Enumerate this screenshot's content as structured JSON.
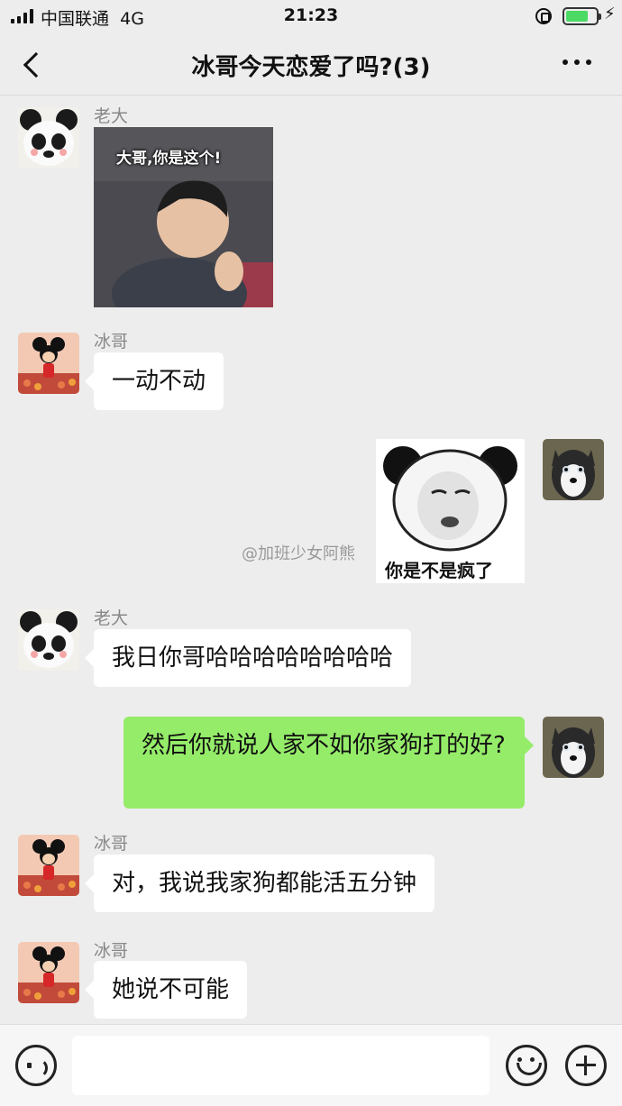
{
  "status_bar": {
    "carrier": "中国联通",
    "network": "4G",
    "time": "21:23",
    "battery_level": 0.75,
    "battery_color": "#4cd964"
  },
  "nav": {
    "back_icon": "chevron-left-icon",
    "title": "冰哥今天恋爱了吗?(3)",
    "more_icon": "more-dots-icon"
  },
  "colors": {
    "background": "#ededed",
    "outgoing_bubble": "#95ec69",
    "incoming_bubble": "#ffffff",
    "sender_name": "#888888"
  },
  "messages": [
    {
      "sender": "老大",
      "type": "sticker",
      "caption": "大哥,你是这个!",
      "direction": "incoming"
    },
    {
      "sender": "冰哥",
      "type": "text",
      "text": "一动不动",
      "direction": "incoming"
    },
    {
      "type": "sticker",
      "caption": "你是不是疯了",
      "direction": "outgoing"
    },
    {
      "sender": "老大",
      "type": "text",
      "text": "我日你哥哈哈哈哈哈哈哈哈",
      "direction": "incoming"
    },
    {
      "type": "text",
      "text": "然后你就说人家不如你家狗打的好?",
      "direction": "outgoing"
    },
    {
      "sender": "冰哥",
      "type": "text",
      "text": "对，我说我家狗都能活五分钟",
      "direction": "incoming"
    },
    {
      "sender": "冰哥",
      "type": "text",
      "text": "她说不可能",
      "direction": "incoming"
    }
  ],
  "watermark": "@加班少女阿熊",
  "input_bar": {
    "voice_icon": "voice-icon",
    "input_value": "",
    "emoji_icon": "emoji-icon",
    "plus_icon": "plus-icon"
  }
}
